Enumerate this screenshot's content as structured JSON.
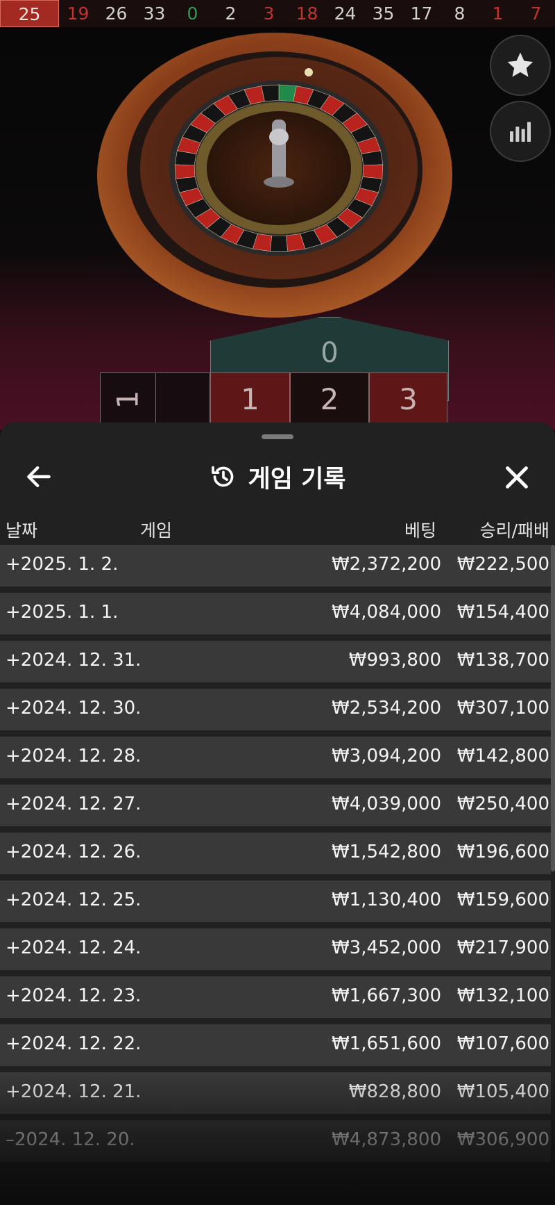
{
  "recent_results": [
    {
      "value": "25",
      "color": "red"
    },
    {
      "value": "19",
      "color": "red"
    },
    {
      "value": "26",
      "color": "black"
    },
    {
      "value": "33",
      "color": "black"
    },
    {
      "value": "0",
      "color": "green"
    },
    {
      "value": "2",
      "color": "black"
    },
    {
      "value": "3",
      "color": "red"
    },
    {
      "value": "18",
      "color": "red"
    },
    {
      "value": "24",
      "color": "black"
    },
    {
      "value": "35",
      "color": "black"
    },
    {
      "value": "17",
      "color": "black"
    },
    {
      "value": "8",
      "color": "black"
    },
    {
      "value": "1",
      "color": "red"
    },
    {
      "value": "7",
      "color": "red"
    }
  ],
  "side_buttons": {
    "favorite_icon": "star-icon",
    "stats_icon": "bar-chart-icon"
  },
  "betting_table": {
    "zero": "0",
    "partial_left": "1",
    "numbers": [
      "1",
      "2",
      "3"
    ]
  },
  "history": {
    "title": "게임 기록",
    "back_icon": "arrow-left-icon",
    "title_icon": "history-icon",
    "close_icon": "close-icon",
    "columns": {
      "date": "날짜",
      "game": "게임",
      "bet": "베팅",
      "result": "승리/패배"
    },
    "rows": [
      {
        "date": "+2025. 1. 2.",
        "bet": "₩2,372,200",
        "result": "₩222,500"
      },
      {
        "date": "+2025. 1. 1.",
        "bet": "₩4,084,000",
        "result": "₩154,400"
      },
      {
        "date": "+2024. 12. 31.",
        "bet": "₩993,800",
        "result": "₩138,700"
      },
      {
        "date": "+2024. 12. 30.",
        "bet": "₩2,534,200",
        "result": "₩307,100"
      },
      {
        "date": "+2024. 12. 28.",
        "bet": "₩3,094,200",
        "result": "₩142,800"
      },
      {
        "date": "+2024. 12. 27.",
        "bet": "₩4,039,000",
        "result": "₩250,400"
      },
      {
        "date": "+2024. 12. 26.",
        "bet": "₩1,542,800",
        "result": "₩196,600"
      },
      {
        "date": "+2024. 12. 25.",
        "bet": "₩1,130,400",
        "result": "₩159,600"
      },
      {
        "date": "+2024. 12. 24.",
        "bet": "₩3,452,000",
        "result": "₩217,900"
      },
      {
        "date": "+2024. 12. 23.",
        "bet": "₩1,667,300",
        "result": "₩132,100"
      },
      {
        "date": "+2024. 12. 22.",
        "bet": "₩1,651,600",
        "result": "₩107,600"
      },
      {
        "date": "+2024. 12. 21.",
        "bet": "₩828,800",
        "result": "₩105,400"
      },
      {
        "date": "–2024. 12. 20.",
        "bet": "₩4,873,800",
        "result": "₩306,900"
      }
    ]
  },
  "colors": {
    "red": "#c0342c",
    "black": "#d0d0d0",
    "green": "#2f9b58",
    "sheet_bg": "#212121",
    "row_bg": "#393939"
  }
}
